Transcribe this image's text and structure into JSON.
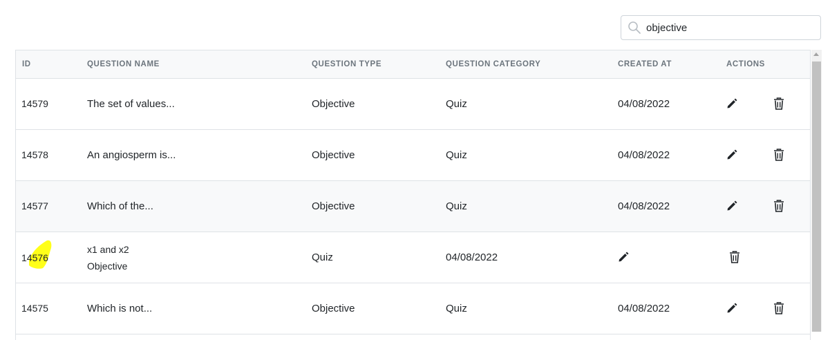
{
  "search": {
    "value": "objective"
  },
  "table": {
    "headers": {
      "id": "ID",
      "name": "QUESTION NAME",
      "type": "QUESTION TYPE",
      "category": "QUESTION CATEGORY",
      "created": "CREATED AT",
      "actions": "ACTIONS"
    },
    "rows": [
      {
        "id": "14579",
        "name": "The set of values...",
        "type": "Objective",
        "category": "Quiz",
        "created": "04/08/2022"
      },
      {
        "id": "14578",
        "name": "An angiosperm is...",
        "type": "Objective",
        "category": "Quiz",
        "created": "04/08/2022"
      },
      {
        "id": "14577",
        "name": "Which of the...",
        "type": "Objective",
        "category": "Quiz",
        "created": "04/08/2022"
      },
      {
        "id": "14576",
        "name_line1": "x1 and x2",
        "name_line2": "Objective",
        "type": "Quiz",
        "category": "04/08/2022"
      },
      {
        "id": "14575",
        "name": "Which is not...",
        "type": "Objective",
        "category": "Quiz",
        "created": "04/08/2022"
      }
    ]
  },
  "icons": {
    "search": "search-icon",
    "edit": "pencil-icon",
    "delete": "trash-icon"
  },
  "colors": {
    "header_bg": "#f8f9fa",
    "border": "#dee2e6",
    "highlight": "#ffff00",
    "muted_text": "#6c757d"
  }
}
